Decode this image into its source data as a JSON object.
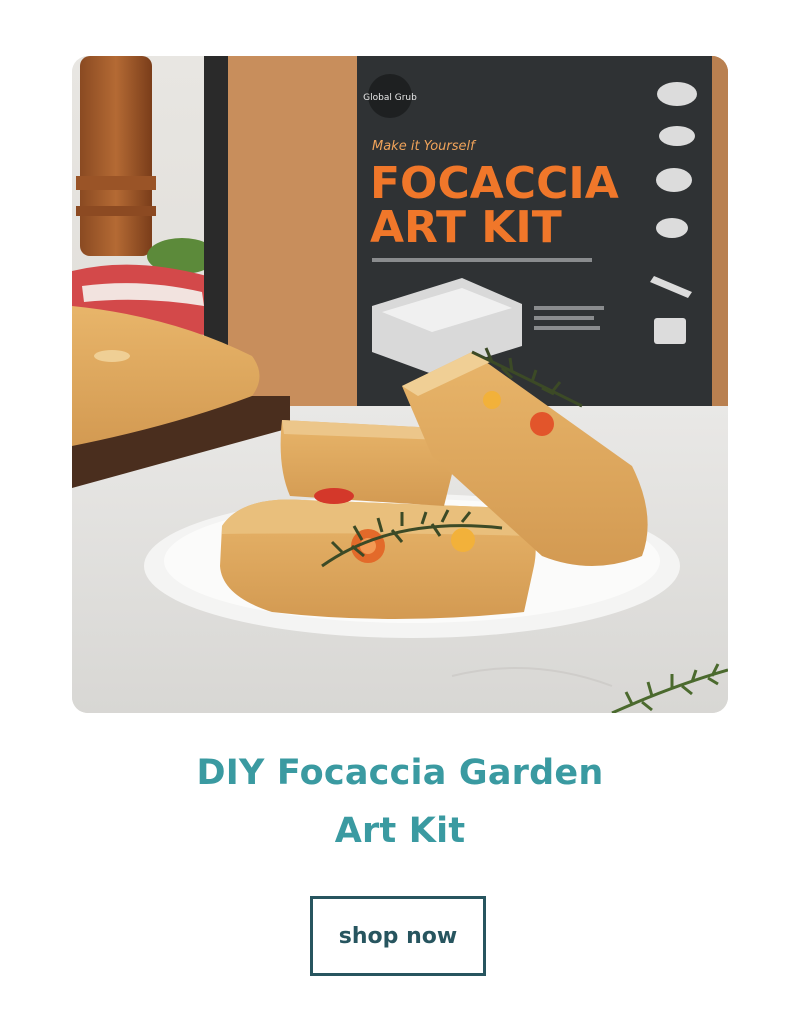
{
  "product": {
    "title_line1": "DIY Focaccia Garden",
    "title_line2": "Art Kit"
  },
  "cta": {
    "label": "shop now"
  },
  "box": {
    "brand": "Global Grub",
    "tagline": "Make it Yourself",
    "headline1": "FOCACCIA",
    "headline2": "ART KIT"
  },
  "colors": {
    "title": "#3a9aa1",
    "button_border": "#27555f",
    "box_orange": "#f0772a",
    "box_dark": "#2f3234"
  }
}
